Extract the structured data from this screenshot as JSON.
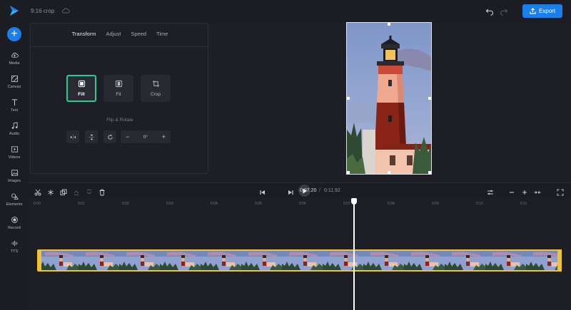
{
  "header": {
    "project_name": "9:16 crop",
    "export_label": "Export"
  },
  "sidebar": {
    "items": [
      {
        "label": "Media",
        "icon": "cloud-upload-icon"
      },
      {
        "label": "Canvas",
        "icon": "canvas-icon"
      },
      {
        "label": "Text",
        "icon": "text-icon"
      },
      {
        "label": "Audio",
        "icon": "music-note-icon"
      },
      {
        "label": "Videos",
        "icon": "video-play-icon"
      },
      {
        "label": "Images",
        "icon": "image-icon"
      },
      {
        "label": "Elements",
        "icon": "shapes-icon"
      },
      {
        "label": "Record",
        "icon": "record-icon"
      },
      {
        "label": "TTS",
        "icon": "waveform-icon"
      }
    ]
  },
  "panel": {
    "tabs": [
      "Transform",
      "Adjust",
      "Speed",
      "Time"
    ],
    "active_tab": "Transform",
    "modes": [
      {
        "label": "Fill",
        "icon": "fill-icon",
        "selected": true
      },
      {
        "label": "Fit",
        "icon": "fit-icon",
        "selected": false
      },
      {
        "label": "Crop",
        "icon": "crop-icon",
        "selected": false
      }
    ],
    "flip_rotate_label": "Flip & Rotate",
    "rotation_value": "0°"
  },
  "timeline": {
    "current_time": "0:07.20",
    "separator": "/",
    "total_time": "0:11.92",
    "ticks": [
      "0:00",
      "0:01",
      "0:02",
      "0:03",
      "0:04",
      "0:05",
      "0:06",
      "0:07",
      "0:08",
      "0:09",
      "0:10",
      "0:11"
    ]
  },
  "colors": {
    "accent": "#1a7fe8",
    "selection": "#1fcf93",
    "clip_border": "#f1c232",
    "background": "#1e1f26"
  }
}
